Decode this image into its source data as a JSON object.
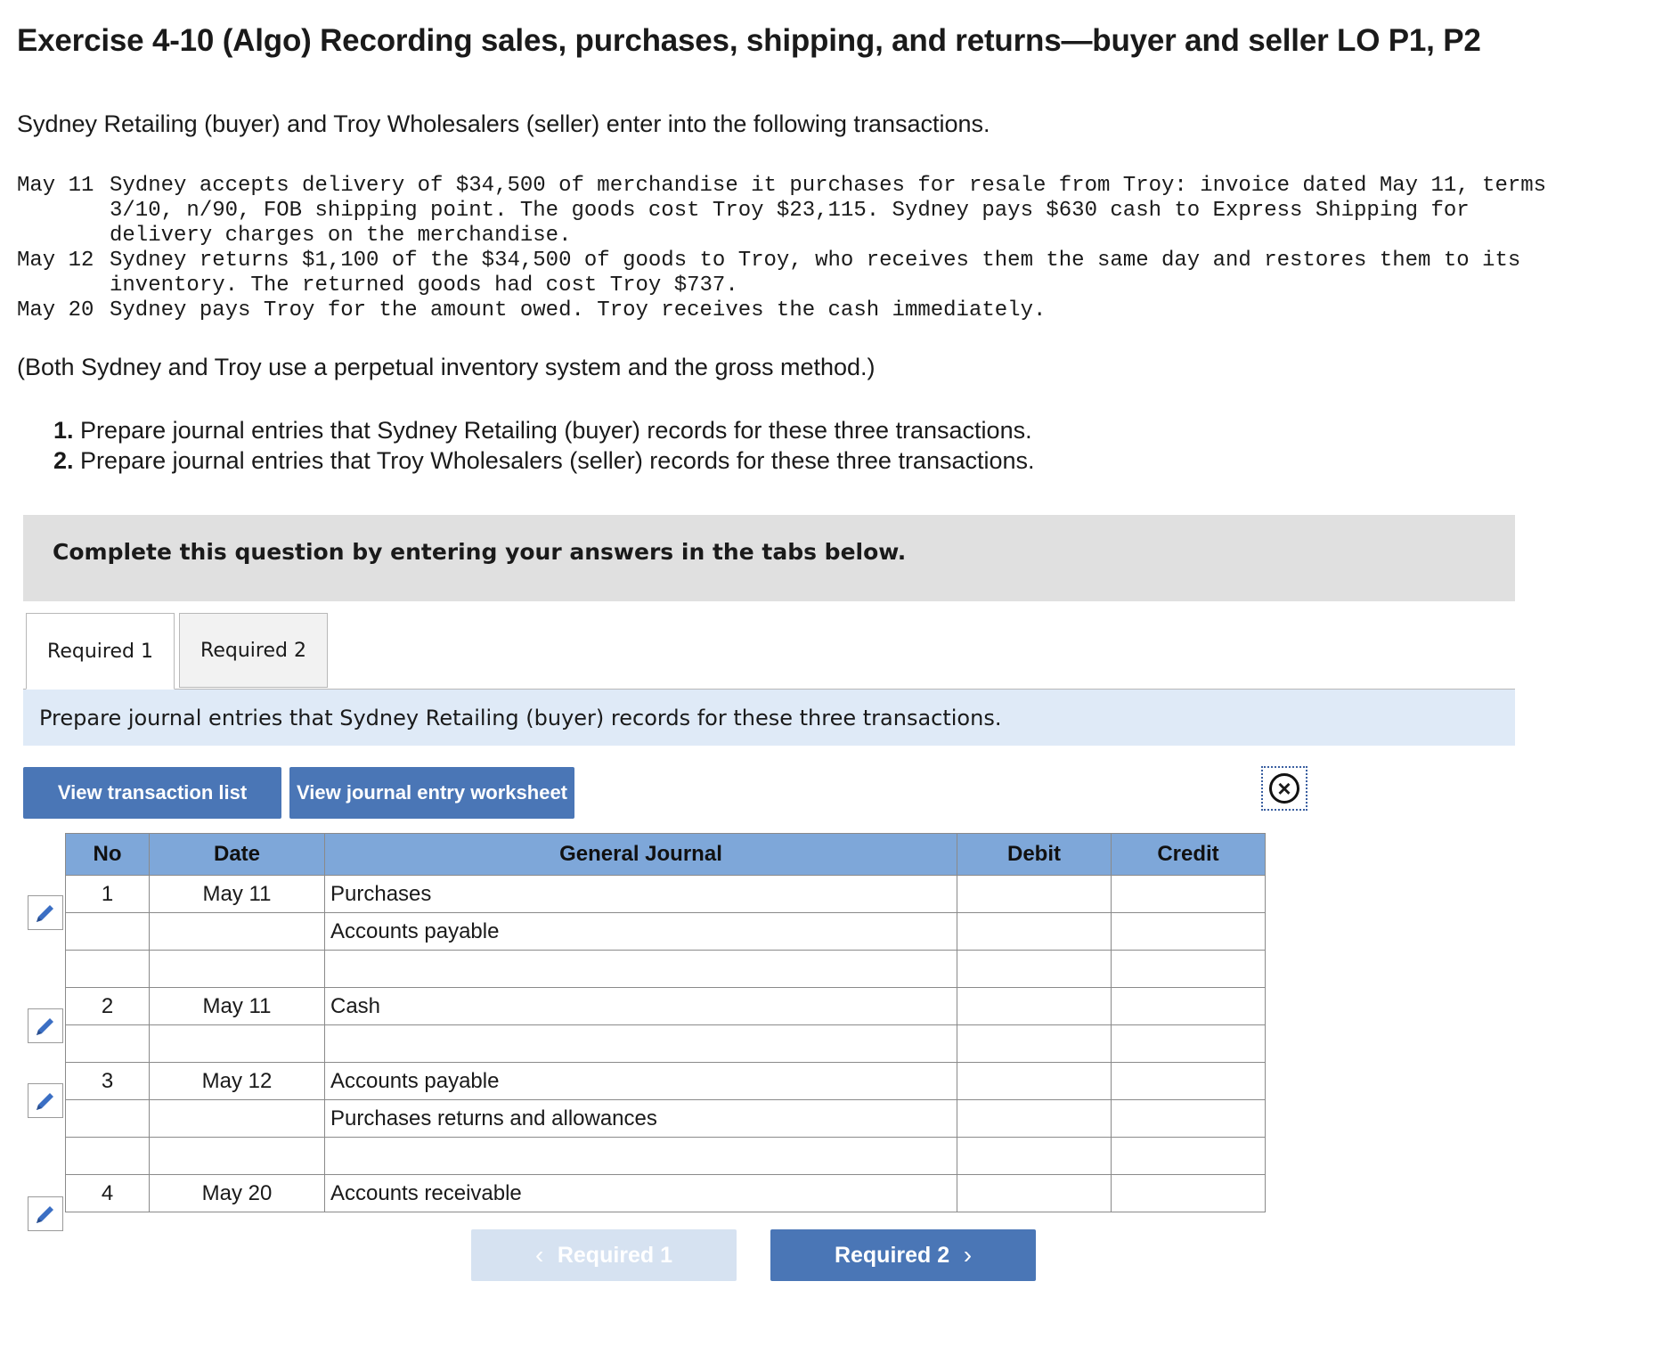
{
  "title": "Exercise 4-10 (Algo) Recording sales, purchases, shipping, and returns—buyer and seller LO P1, P2",
  "intro": "Sydney Retailing (buyer) and Troy Wholesalers (seller) enter into the following transactions.",
  "transactions": [
    {
      "date": "May 11",
      "text": "Sydney accepts delivery of $34,500 of merchandise it purchases for resale from Troy: invoice dated May 11, terms 3/10, n/90, FOB shipping point. The goods cost Troy $23,115. Sydney pays $630 cash to Express Shipping for delivery charges on the merchandise."
    },
    {
      "date": "May 12",
      "text": "Sydney returns $1,100 of the $34,500 of goods to Troy, who receives them the same day and restores them to its inventory. The returned goods had cost Troy $737."
    },
    {
      "date": "May 20",
      "text": "Sydney pays Troy for the amount owed. Troy receives the cash immediately."
    }
  ],
  "note": "(Both Sydney and Troy use a perpetual inventory system and the gross method.)",
  "requirements": [
    {
      "num": "1.",
      "text": "Prepare journal entries that Sydney Retailing (buyer) records for these three transactions."
    },
    {
      "num": "2.",
      "text": "Prepare journal entries that Troy Wholesalers (seller) records for these three transactions."
    }
  ],
  "banner": "Complete this question by entering your answers in the tabs below.",
  "tabs": [
    "Required 1",
    "Required 2"
  ],
  "instruction": "Prepare journal entries that Sydney Retailing (buyer) records for these three transactions.",
  "buttons": {
    "transaction_list": "View transaction list",
    "worksheet": "View journal entry worksheet"
  },
  "table": {
    "headers": {
      "no": "No",
      "date": "Date",
      "journal": "General Journal",
      "debit": "Debit",
      "credit": "Credit"
    },
    "rows": [
      {
        "no": "1",
        "date": "May 11",
        "account": "Purchases",
        "debit": "",
        "credit": ""
      },
      {
        "no": "",
        "date": "",
        "account": "Accounts payable",
        "debit": "",
        "credit": ""
      },
      {
        "no": "",
        "date": "",
        "account": "",
        "debit": "",
        "credit": ""
      },
      {
        "no": "2",
        "date": "May 11",
        "account": "Cash",
        "debit": "",
        "credit": ""
      },
      {
        "no": "",
        "date": "",
        "account": "",
        "debit": "",
        "credit": ""
      },
      {
        "no": "3",
        "date": "May 12",
        "account": "Accounts payable",
        "debit": "",
        "credit": ""
      },
      {
        "no": "",
        "date": "",
        "account": "Purchases returns and allowances",
        "debit": "",
        "credit": ""
      },
      {
        "no": "",
        "date": "",
        "account": "",
        "debit": "",
        "credit": ""
      },
      {
        "no": "4",
        "date": "May 20",
        "account": "Accounts receivable",
        "debit": "",
        "credit": ""
      }
    ]
  },
  "nav": {
    "prev": "Required 1",
    "next": "Required 2"
  },
  "colors": {
    "button_blue": "#4a76b6",
    "header_blue": "#7ea7d9",
    "instruction_bg": "#dfeaf7",
    "banner_bg": "#e0e0e0",
    "disabled_nav": "#d6e2f1"
  }
}
